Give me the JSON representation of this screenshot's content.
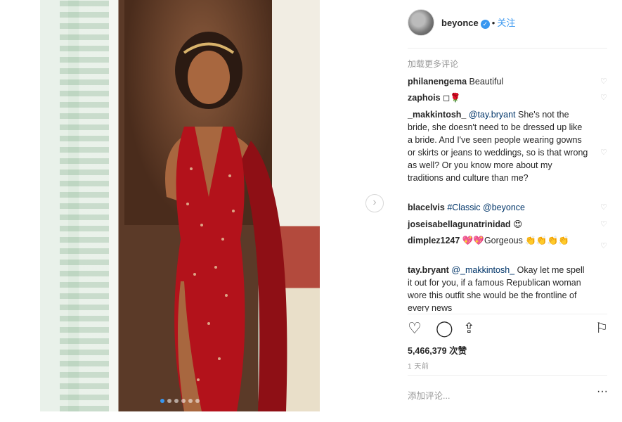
{
  "post": {
    "username": "beyonce",
    "follow_label": "关注",
    "dot": "•"
  },
  "comments": {
    "load_more": "加载更多评论",
    "items": [
      {
        "user": "philanengema",
        "text": "Beautiful"
      },
      {
        "user": "zaphois",
        "text": "◻🌹"
      },
      {
        "user": "_makkintosh_",
        "mention": "@tay.bryant",
        "text": "She's not the bride, she doesn't need to be dressed up like a bride. And I've seen people wearing gowns or skirts or jeans to weddings, so is that wrong as well? Or you know more about my traditions and culture than me?"
      },
      {
        "user": "blacelvis",
        "mention": "#Classic @beyonce",
        "text": ""
      },
      {
        "user": "joseisabellagunatrinidad",
        "text": "😍"
      },
      {
        "user": "dimplez1247",
        "text": "💖💖Gorgeous 👏👏👏👏"
      },
      {
        "user": "tay.bryant",
        "mention": "@_makkintosh_",
        "text": "Okay let me spell it out for you, if a famous Republican woman wore this outfit she would be the frontline of every news"
      }
    ]
  },
  "stats": {
    "likes": "5,466,379 次赞",
    "time": "1 天前"
  },
  "composer": {
    "placeholder": "添加评论...",
    "more": "···"
  },
  "icons": {
    "heart": "heart-icon",
    "comment": "comment-icon",
    "share": "share-icon",
    "bookmark": "bookmark-icon",
    "next": "chevron-right-icon"
  },
  "colors": {
    "accent": "#3897f0",
    "dress": "#b3121b",
    "text": "#262626",
    "muted": "#999999"
  }
}
